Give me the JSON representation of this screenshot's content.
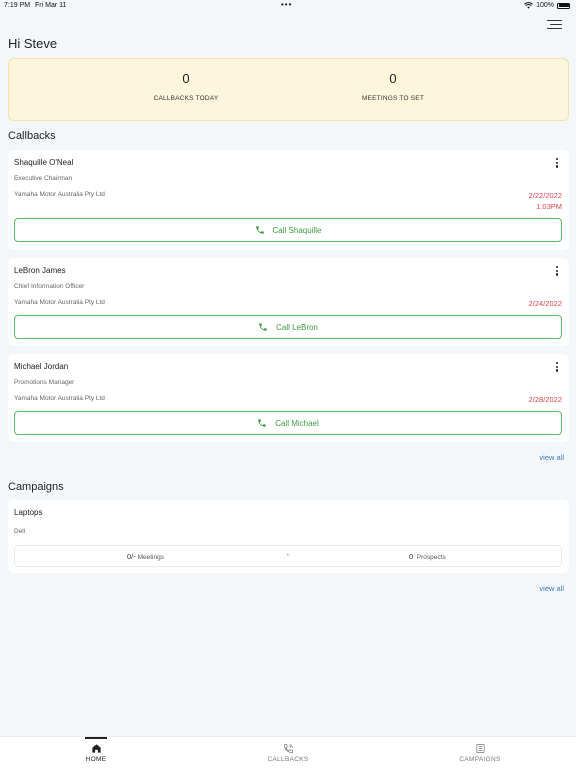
{
  "status_bar": {
    "time": "7:19 PM",
    "date": "Fri Mar 11",
    "battery": "100%"
  },
  "header": {
    "greeting": "Hi Steve",
    "menu_icon": "hamburger-icon"
  },
  "summary": {
    "callbacks_today": {
      "value": "0",
      "label": "CALLBACKS TODAY"
    },
    "meetings_to_set": {
      "value": "0",
      "label": "MEETINGS TO SET"
    }
  },
  "callbacks": {
    "title": "Callbacks",
    "items": [
      {
        "name": "Shaquille O'Neal",
        "role": "Executive Chairman",
        "company": "Yamaha Motor Australia Pty Ltd",
        "date": "2/22/2022",
        "time": "1:03PM",
        "call_label": "Call Shaquille"
      },
      {
        "name": "LeBron James",
        "role": "Chief Information Officer",
        "company": "Yamaha Motor Australia Pty Ltd",
        "date": "2/24/2022",
        "time": "",
        "call_label": "Call LeBron"
      },
      {
        "name": "Michael Jordan",
        "role": "Promotions Manager",
        "company": "Yamaha Motor Australia Pty Ltd",
        "date": "2/28/2022",
        "time": "",
        "call_label": "Call Michael"
      }
    ],
    "view_all": "view all"
  },
  "campaigns": {
    "title": "Campaigns",
    "items": [
      {
        "name": "Laptops",
        "client": "Dell",
        "meetings_value": "0/-",
        "meetings_label": "Meetings",
        "separator": "+",
        "prospects_value": "0",
        "prospects_label": "Prospects"
      }
    ],
    "view_all": "view all"
  },
  "tabbar": {
    "tabs": [
      {
        "label": "HOME",
        "icon": "home-icon",
        "active": true
      },
      {
        "label": "CALLBACKS",
        "icon": "phone-icon",
        "active": false
      },
      {
        "label": "CAMPAIGNS",
        "icon": "list-icon",
        "active": false
      }
    ]
  },
  "colors": {
    "accent_green": "#5cb85c",
    "date_red": "#e0474c",
    "link_blue": "#3b7bbf",
    "summary_bg": "#fdf6dc"
  }
}
